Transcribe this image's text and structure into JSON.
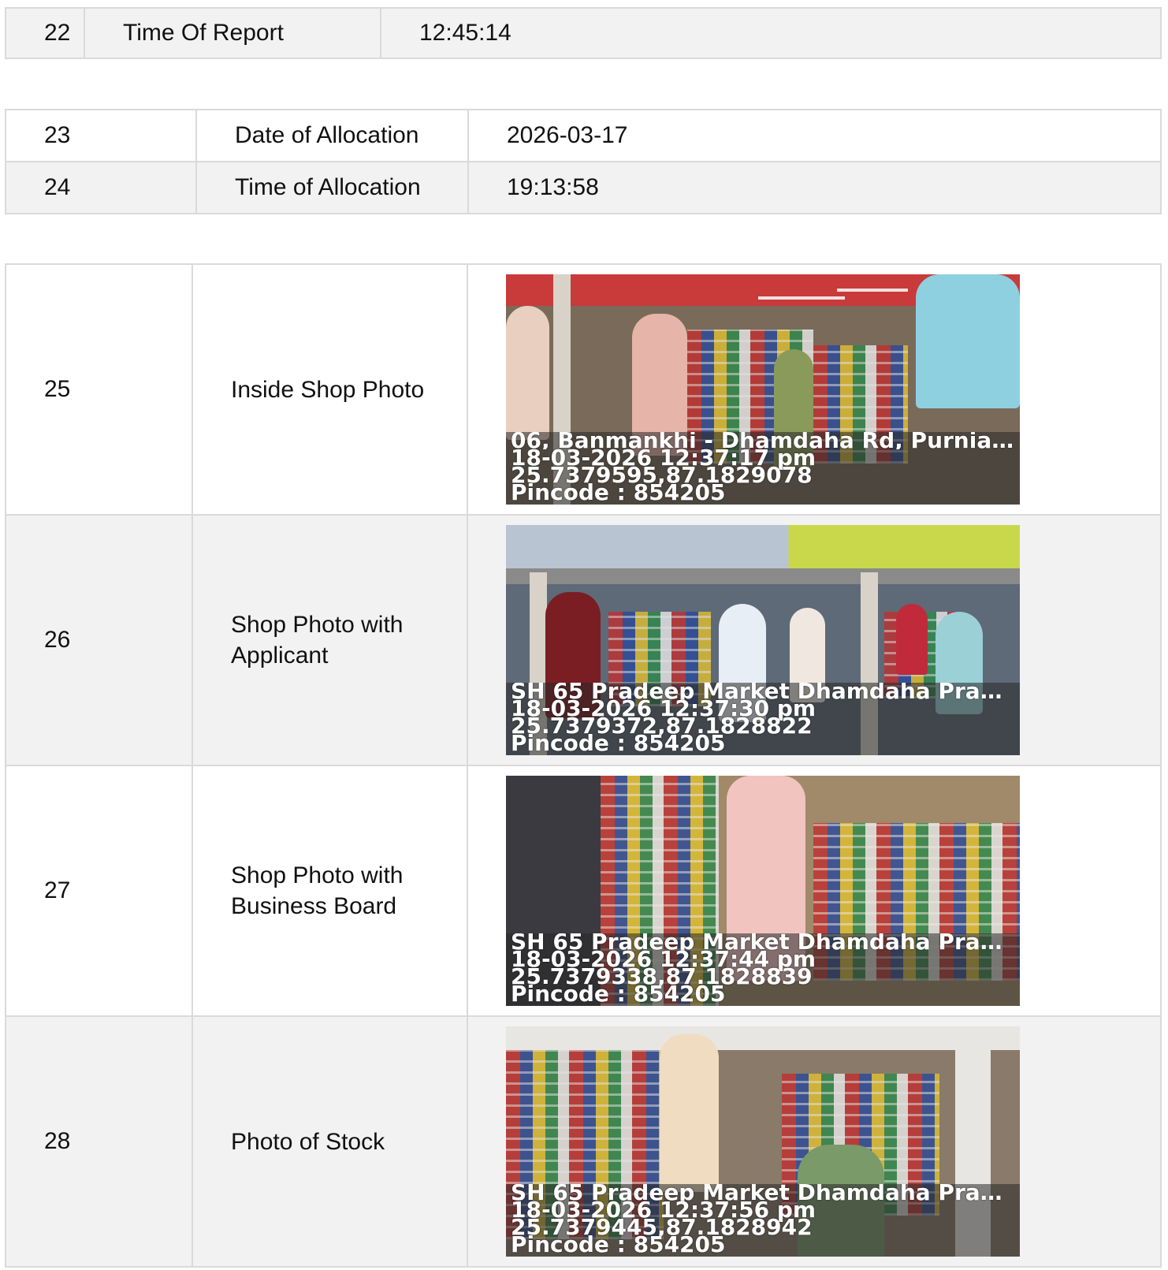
{
  "table1": {
    "rows": [
      {
        "no": "22",
        "label": "Time Of Report",
        "value": "12:45:14"
      }
    ]
  },
  "table2": {
    "rows": [
      {
        "no": "23",
        "label": "Date of Allocation",
        "value": "2026-03-17"
      },
      {
        "no": "24",
        "label": "Time of Allocation",
        "value": "19:13:58"
      }
    ]
  },
  "table3": {
    "rows": [
      {
        "no": "25",
        "label": "Inside Shop Photo",
        "photo": {
          "address": "06, Banmankhi - Dhamdaha Rd, Purnia, ...",
          "datetime": "18-03-2026 12:37:17 pm",
          "coords": "25.7379595,87.1829078",
          "pincode": "Pincode : 854205"
        }
      },
      {
        "no": "26",
        "label": "Shop Photo with Applicant",
        "photo": {
          "address": "SH 65 Pradeep Market Dhamdaha Pradeep ...",
          "datetime": "18-03-2026 12:37:30 pm",
          "coords": "25.7379372,87.1828822",
          "pincode": "Pincode : 854205"
        }
      },
      {
        "no": "27",
        "label": "Shop Photo with Business Board",
        "photo": {
          "address": "SH 65 Pradeep Market Dhamdaha Pradeep ...",
          "datetime": "18-03-2026 12:37:44 pm",
          "coords": "25.7379338,87.1828839",
          "pincode": "Pincode : 854205"
        }
      },
      {
        "no": "28",
        "label": "Photo of Stock",
        "photo": {
          "address": "SH 65 Pradeep Market Dhamdaha Pradeep ...",
          "datetime": "18-03-2026 12:37:56 pm",
          "coords": "25.7379445,87.1828942",
          "pincode": "Pincode : 854205"
        }
      }
    ]
  }
}
